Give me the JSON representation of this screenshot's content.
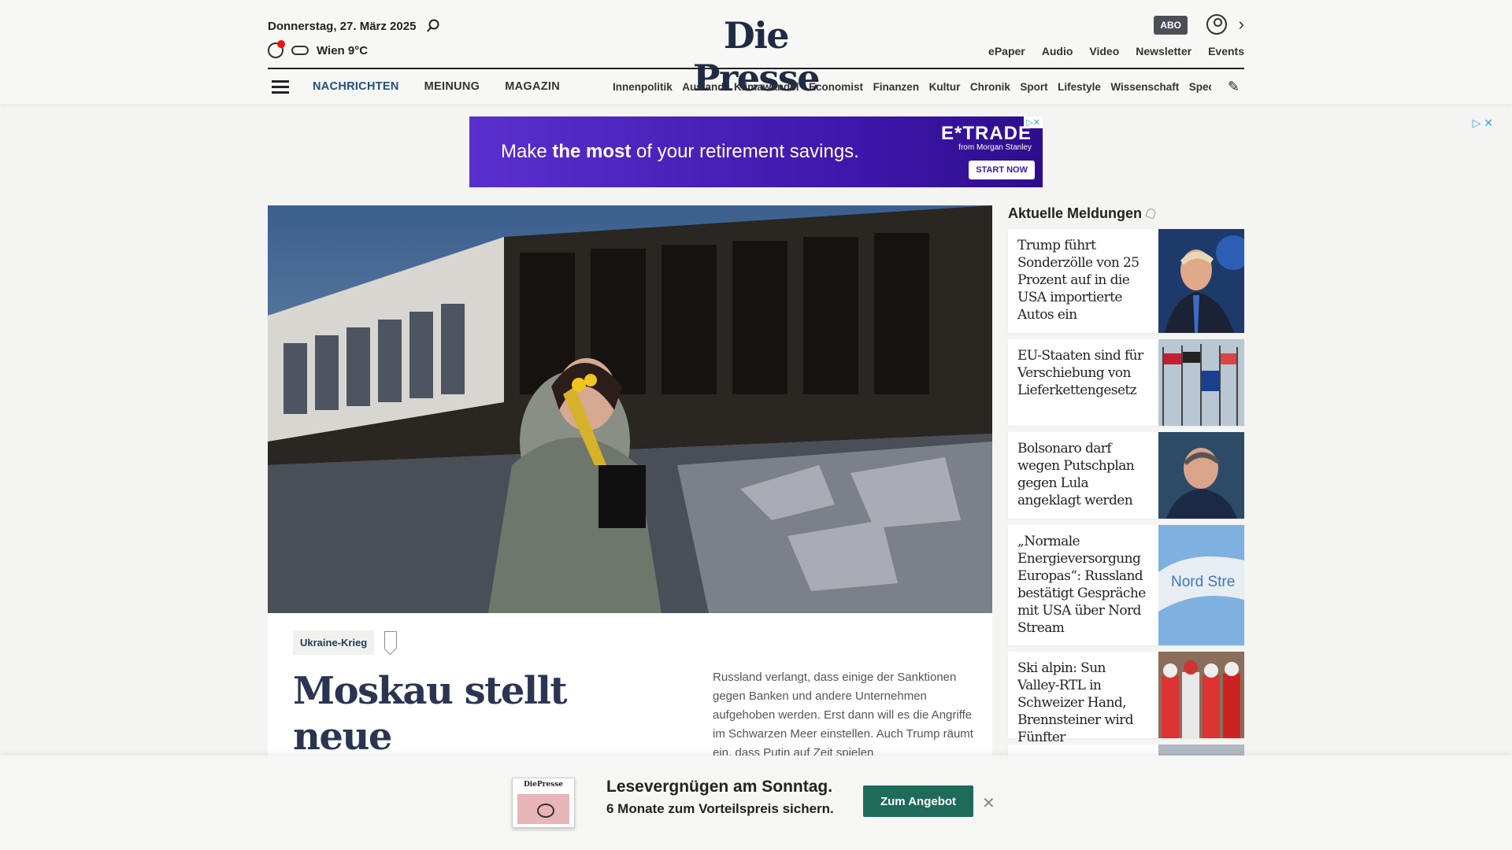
{
  "header": {
    "date": "Donnerstag, 27. März 2025",
    "weather": "Wien 9°C",
    "logo": "Die Presse",
    "abo_label": "ABO",
    "top_links": [
      "ePaper",
      "Audio",
      "Video",
      "Newsletter",
      "Events"
    ]
  },
  "nav": {
    "main": [
      "NACHRICHTEN",
      "MEINUNG",
      "MAGAZIN"
    ],
    "active": "NACHRICHTEN",
    "sections": [
      "Innenpolitik",
      "Ausland",
      "Klimawandel",
      "Economist",
      "Finanzen",
      "Kultur",
      "Chronik",
      "Sport",
      "Lifestyle",
      "Wissenschaft",
      "Spectrum"
    ]
  },
  "ad": {
    "text_pre": "Make ",
    "text_bold": "the most",
    "text_post": " of your retirement savings.",
    "brand": "E*TRADE",
    "brand_sub": "from Morgan Stanley",
    "cta": "START NOW"
  },
  "article": {
    "tag": "Ukraine-Krieg",
    "headline": "Moskau stellt neue Bedingungen für",
    "teaser": "Russland verlangt, dass einige der Sanktionen gegen Banken und andere Unternehmen aufgehoben werden. Erst dann will es die Angriffe im Schwarzen Meer einstellen. Auch Trump räumt ein, dass Putin auf Zeit spielen"
  },
  "sidebar": {
    "title": "Aktuelle Meldungen",
    "items": [
      {
        "text": "Trump führt Sonderzölle von 25 Prozent auf in die USA importierte Autos ein"
      },
      {
        "text": "EU-Staaten sind für Verschiebung von Lieferkettengesetz"
      },
      {
        "text": "Bolsonaro darf wegen Putschplan gegen Lula angeklagt werden"
      },
      {
        "text": "„Normale Energieversorgung Europas“: Russland bestätigt Gespräche mit USA über Nord Stream"
      },
      {
        "text": "Ski alpin: Sun Valley-RTL in Schweizer Hand, Brennsteiner wird Fünfter"
      }
    ]
  },
  "promo": {
    "thumb_logo": "DiePresse",
    "title": "Lesevergnügen am Sonntag.",
    "subtitle": "6 Monate zum Vorteilspreis sichern.",
    "button": "Zum Angebot"
  }
}
